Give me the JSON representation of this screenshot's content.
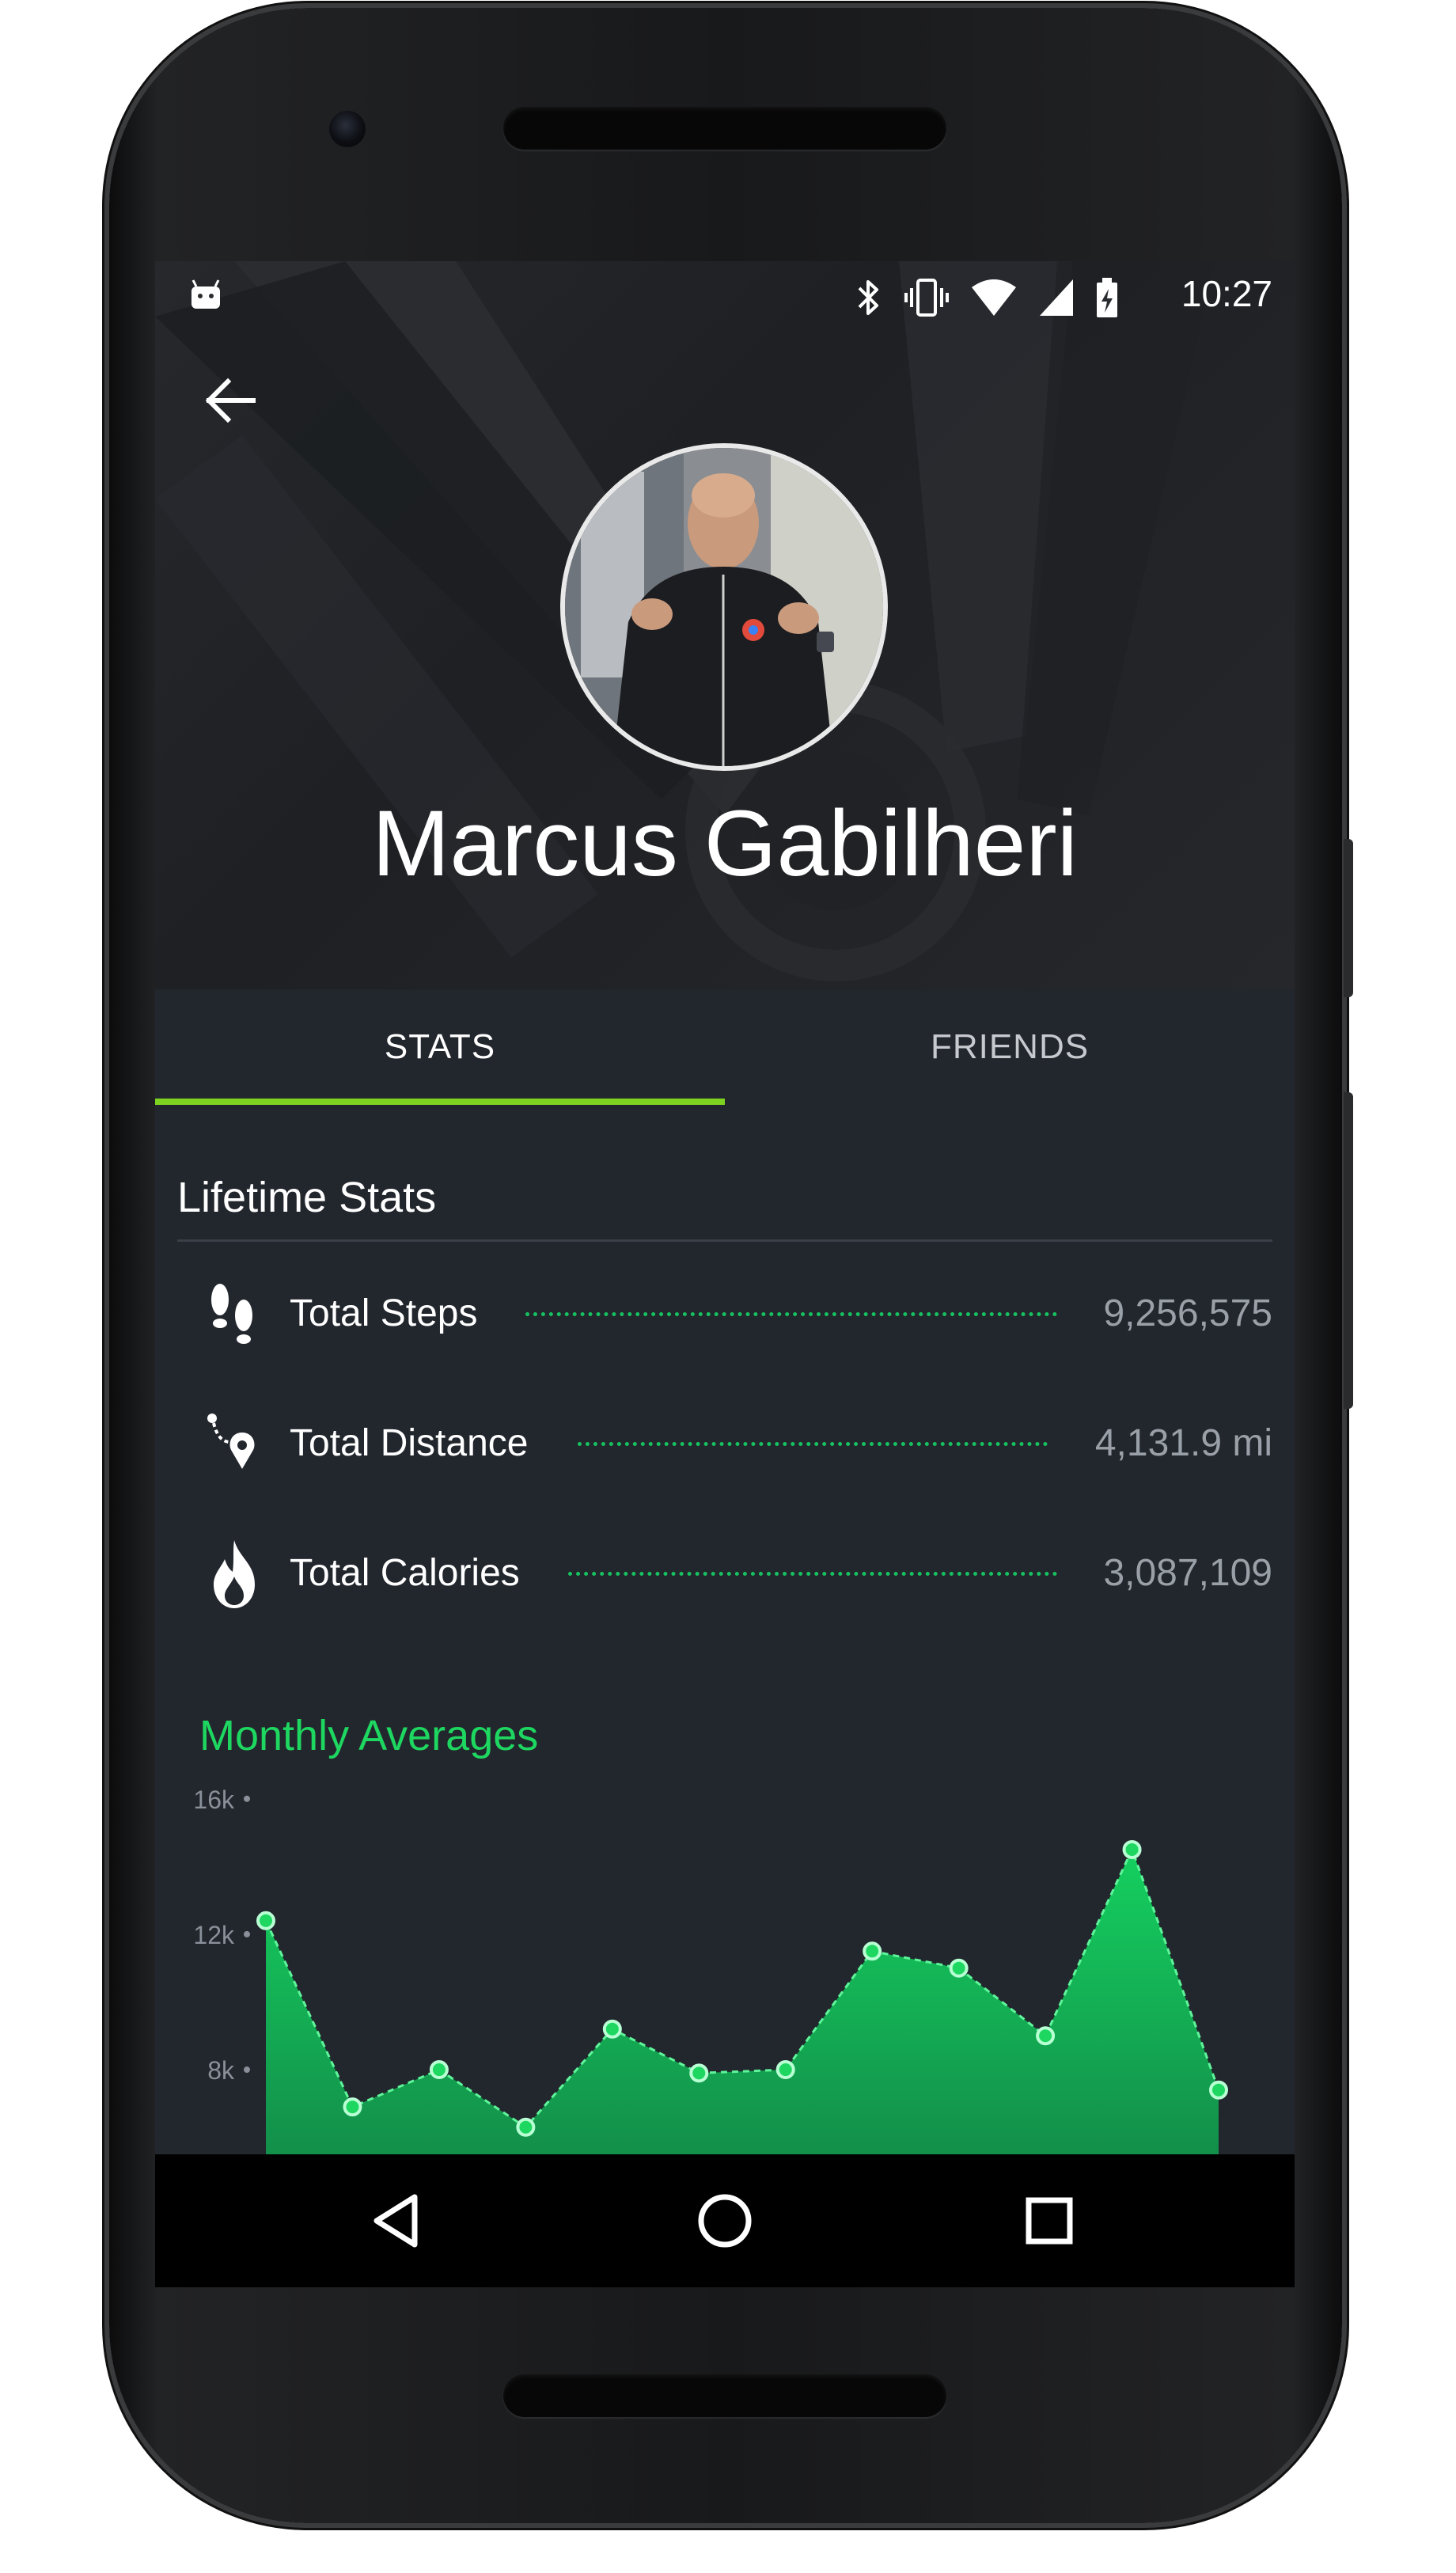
{
  "status_bar": {
    "time": "10:27",
    "icons": [
      "android-notification-icon",
      "bluetooth-icon",
      "vibrate-icon",
      "wifi-icon",
      "signal-icon",
      "battery-charging-icon"
    ]
  },
  "header": {
    "back_icon": "arrow-back-icon",
    "profile_name": "Marcus Gabilheri"
  },
  "tabs": [
    {
      "label": "STATS",
      "selected": true
    },
    {
      "label": "FRIENDS",
      "selected": false
    }
  ],
  "colors": {
    "accent": "#7ed321",
    "chart_green": "#1ed760",
    "dots": "#17c160",
    "background": "#22262d"
  },
  "lifetime_stats": {
    "title": "Lifetime Stats",
    "items": [
      {
        "icon": "footsteps-icon",
        "label": "Total Steps",
        "value": "9,256,575"
      },
      {
        "icon": "route-pin-icon",
        "label": "Total Distance",
        "value": "4,131.9 mi"
      },
      {
        "icon": "flame-icon",
        "label": "Total Calories",
        "value": "3,087,109"
      }
    ]
  },
  "monthly_averages": {
    "title": "Monthly Averages"
  },
  "chart_data": {
    "type": "area",
    "title": "Monthly Averages",
    "ytick_labels": [
      "16k",
      "12k",
      "8k"
    ],
    "ylim": [
      5500,
      17000
    ],
    "yticks": [
      16000,
      12000,
      8000
    ],
    "x": [
      1,
      2,
      3,
      4,
      5,
      6,
      7,
      8,
      9,
      10,
      11,
      12
    ],
    "values": [
      12400,
      6900,
      8000,
      6300,
      9200,
      7900,
      8000,
      11500,
      11000,
      9000,
      14500,
      7400
    ],
    "grid": false,
    "legend": "none"
  },
  "nav_bar": {
    "buttons": [
      "back-triangle-icon",
      "home-circle-icon",
      "recents-square-icon"
    ]
  }
}
